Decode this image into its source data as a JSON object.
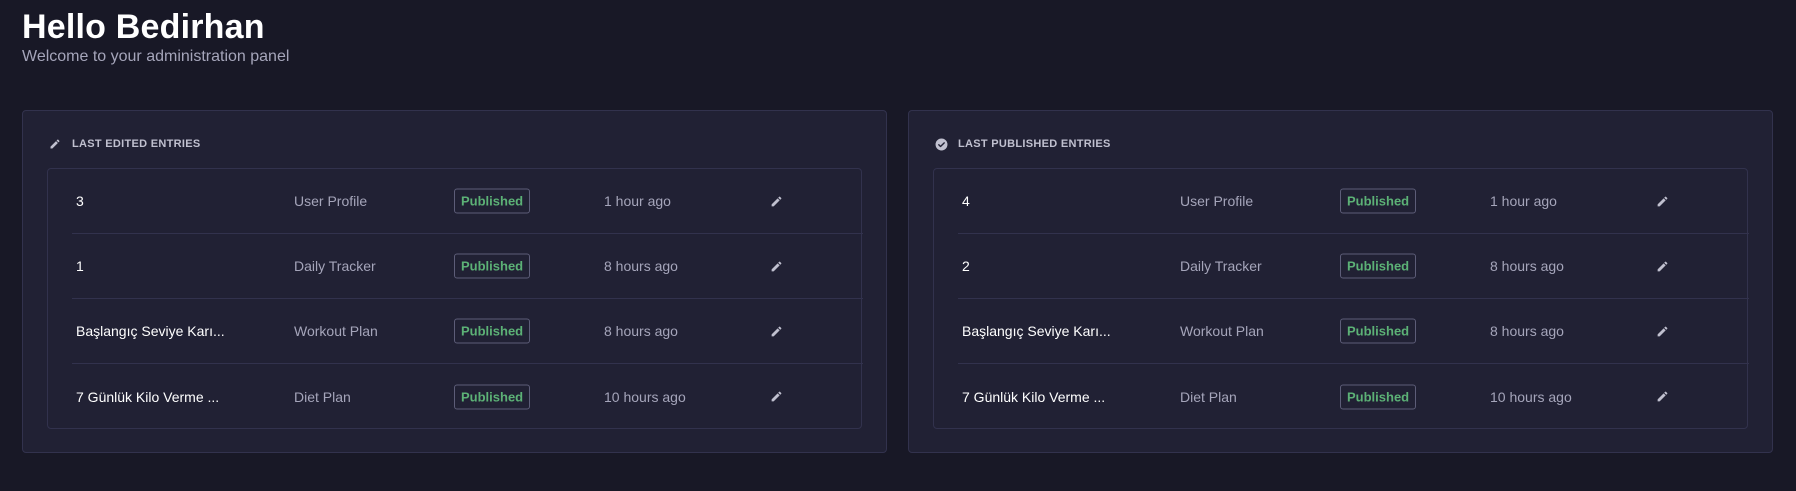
{
  "header": {
    "greeting": "Hello Bedirhan",
    "subtitle": "Welcome to your administration panel"
  },
  "panels": [
    {
      "title": "LAST EDITED ENTRIES",
      "icon": "pencil-icon",
      "rows": [
        {
          "title": "3",
          "type": "User Profile",
          "status": "Published",
          "time": "1 hour ago"
        },
        {
          "title": "1",
          "type": "Daily Tracker",
          "status": "Published",
          "time": "8 hours ago"
        },
        {
          "title": "Başlangıç Seviye Karı...",
          "type": "Workout Plan",
          "status": "Published",
          "time": "8 hours ago"
        },
        {
          "title": "7 Günlük Kilo Verme ...",
          "type": "Diet Plan",
          "status": "Published",
          "time": "10 hours ago"
        }
      ]
    },
    {
      "title": "LAST PUBLISHED ENTRIES",
      "icon": "check-circle-icon",
      "rows": [
        {
          "title": "4",
          "type": "User Profile",
          "status": "Published",
          "time": "1 hour ago"
        },
        {
          "title": "2",
          "type": "Daily Tracker",
          "status": "Published",
          "time": "8 hours ago"
        },
        {
          "title": "Başlangıç Seviye Karı...",
          "type": "Workout Plan",
          "status": "Published",
          "time": "8 hours ago"
        },
        {
          "title": "7 Günlük Kilo Verme ...",
          "type": "Diet Plan",
          "status": "Published",
          "time": "10 hours ago"
        }
      ]
    }
  ],
  "colors": {
    "background": "#181826",
    "panel": "#212134",
    "border": "#32324d",
    "published": "#5cb176",
    "muted_text": "#a5a5ba"
  }
}
